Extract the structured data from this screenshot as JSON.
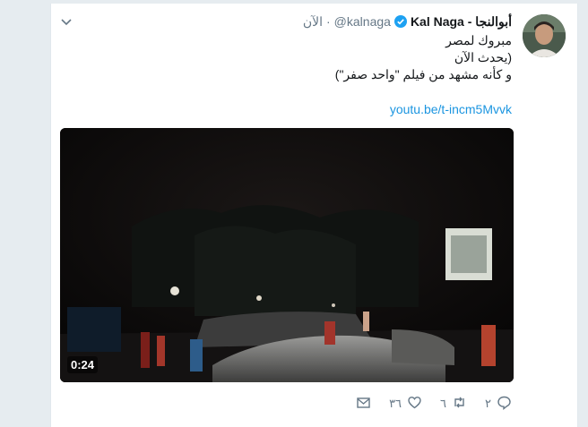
{
  "tweet": {
    "author_name": "Kal Naga - أبوالنجا",
    "handle": "@kalnaga",
    "separator": "·",
    "time": "الآن",
    "lines": [
      "مبروك لمصر",
      "(يحدث الآن",
      "و كأنه مشهد من فيلم \"واحد صفر\")"
    ],
    "link": "youtu.be/t-incm5Mvvk"
  },
  "video": {
    "duration": "0:24"
  },
  "actions": {
    "replies": "٢",
    "retweets": "٦",
    "likes": "٣٦"
  },
  "colors": {
    "link": "#1b95e0",
    "muted": "#657786",
    "verified": "#1da1f2"
  },
  "icons": [
    "chevron-down-icon",
    "verified-badge-icon",
    "reply-icon",
    "retweet-icon",
    "like-icon",
    "message-icon"
  ]
}
